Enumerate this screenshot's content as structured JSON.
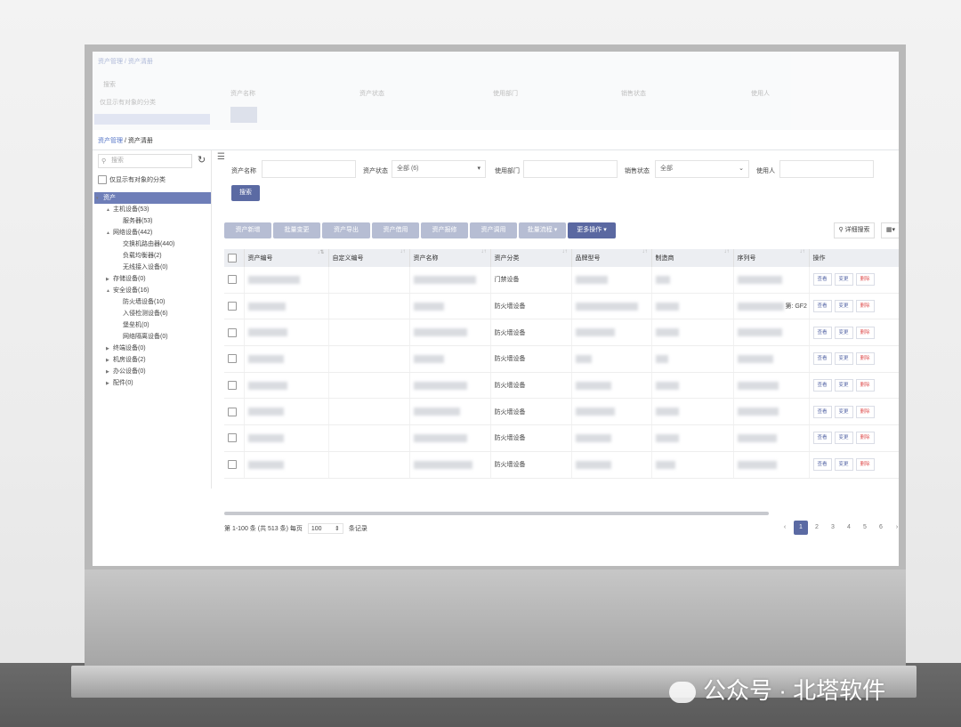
{
  "breadcrumb": {
    "root": "资产管理",
    "sep": "/",
    "current": "资产清册"
  },
  "sidebar": {
    "search_placeholder": "搜索",
    "only_objects_label": "仅显示有对象的分类",
    "tree": [
      {
        "label": "资产",
        "level": 0,
        "selected": true
      },
      {
        "label": "主机设备(53)",
        "level": 1,
        "expanded": true
      },
      {
        "label": "服务器(53)",
        "level": 2
      },
      {
        "label": "网络设备(442)",
        "level": 1,
        "expanded": true
      },
      {
        "label": "交换机路由器(440)",
        "level": 2
      },
      {
        "label": "负载均衡器(2)",
        "level": 2
      },
      {
        "label": "无线接入设备(0)",
        "level": 2
      },
      {
        "label": "存储设备(0)",
        "level": 1
      },
      {
        "label": "安全设备(16)",
        "level": 1,
        "expanded": true
      },
      {
        "label": "防火墙设备(10)",
        "level": 2
      },
      {
        "label": "入侵检测设备(6)",
        "level": 2
      },
      {
        "label": "堡垒机(0)",
        "level": 2
      },
      {
        "label": "网络隔离设备(0)",
        "level": 2
      },
      {
        "label": "终端设备(0)",
        "level": 1
      },
      {
        "label": "机房设备(2)",
        "level": 1
      },
      {
        "label": "办公设备(0)",
        "level": 1
      },
      {
        "label": "配件(0)",
        "level": 1
      }
    ]
  },
  "filters": {
    "asset_name_label": "资产名称",
    "asset_status_label": "资产状态",
    "asset_status_value": "全部 (6)",
    "use_dept_label": "使用部门",
    "sale_status_label": "销售状态",
    "sale_status_value": "全部",
    "user_label": "使用人",
    "search_button": "搜索"
  },
  "toolbar": {
    "buttons": [
      "资产新增",
      "批量变更",
      "资产导出",
      "资产借用",
      "资产报修",
      "资产调用",
      "批量流程",
      "更多操作"
    ],
    "advanced_search": "详细搜索"
  },
  "table": {
    "headers": [
      "资产编号",
      "自定义编号",
      "资产名称",
      "资产分类",
      "品牌型号",
      "制造商",
      "序列号",
      "操作"
    ],
    "rows": [
      {
        "category": "门禁设备",
        "serial_suffix": ""
      },
      {
        "category": "防火墙设备",
        "serial_suffix": "第: GF2"
      },
      {
        "category": "防火墙设备",
        "serial_suffix": ""
      },
      {
        "category": "防火墙设备",
        "serial_suffix": ""
      },
      {
        "category": "防火墙设备",
        "serial_suffix": ""
      },
      {
        "category": "防火墙设备",
        "serial_suffix": ""
      },
      {
        "category": "防火墙设备",
        "serial_suffix": ""
      },
      {
        "category": "防火墙设备",
        "serial_suffix": ""
      }
    ],
    "actions": {
      "view": "查看",
      "change": "变更",
      "delete": "删除"
    }
  },
  "pagination": {
    "info": "第 1-100 条 (共 513 条)",
    "per_page_label": "每页",
    "per_page_value": "100",
    "records_label": "条记录",
    "prev": "‹",
    "next": "›",
    "pages": [
      "1",
      "2",
      "3",
      "4",
      "5",
      "6"
    ],
    "current": "1"
  },
  "watermark": "公众号 · 北塔软件",
  "colors": {
    "accent": "#5b6aa3",
    "accent_light": "#b6bdd3",
    "selected_node": "#6e7eb8",
    "delete": "#e05555"
  }
}
